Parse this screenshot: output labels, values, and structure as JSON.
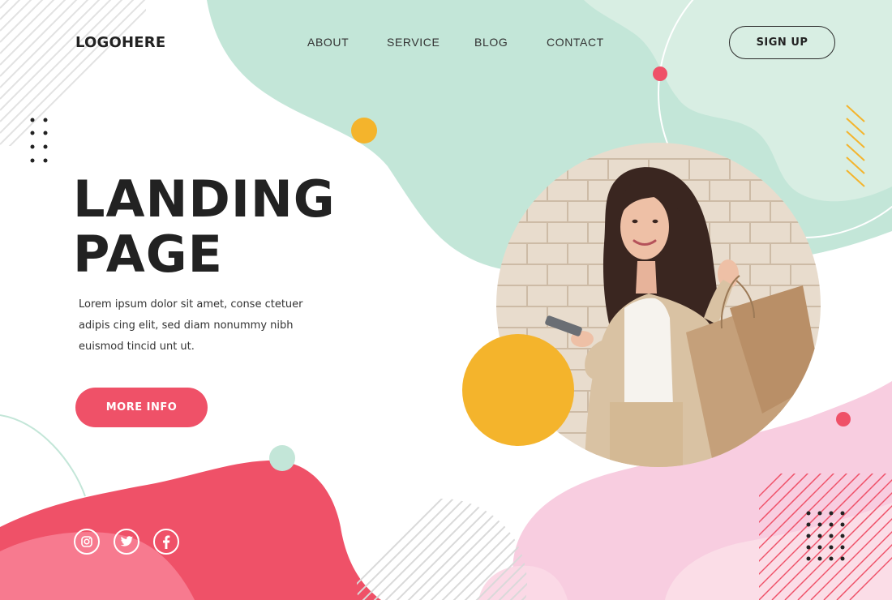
{
  "header": {
    "logo": "LOGOHERE",
    "nav": [
      {
        "label": "ABOUT"
      },
      {
        "label": "SERVICE"
      },
      {
        "label": "BLOG"
      },
      {
        "label": "CONTACT"
      }
    ],
    "signup_label": "SIGN UP"
  },
  "hero": {
    "title_line1": "LANDING",
    "title_line2": "PAGE",
    "description_lines": [
      "Lorem ipsum dolor sit amet, conse ctetuer",
      "adipis cing elit, sed diam nonummy nibh",
      "euismod tincid unt ut."
    ],
    "cta_label": "MORE INFO"
  },
  "social": [
    {
      "icon": "instagram-icon"
    },
    {
      "icon": "twitter-icon"
    },
    {
      "icon": "facebook-icon"
    }
  ],
  "colors": {
    "accent_pink": "#ef5168",
    "light_pink": "#f8cde0",
    "mint": "#c3e6d8",
    "light_mint": "#d8eee3",
    "yellow": "#f4b42c",
    "text": "#222222"
  }
}
